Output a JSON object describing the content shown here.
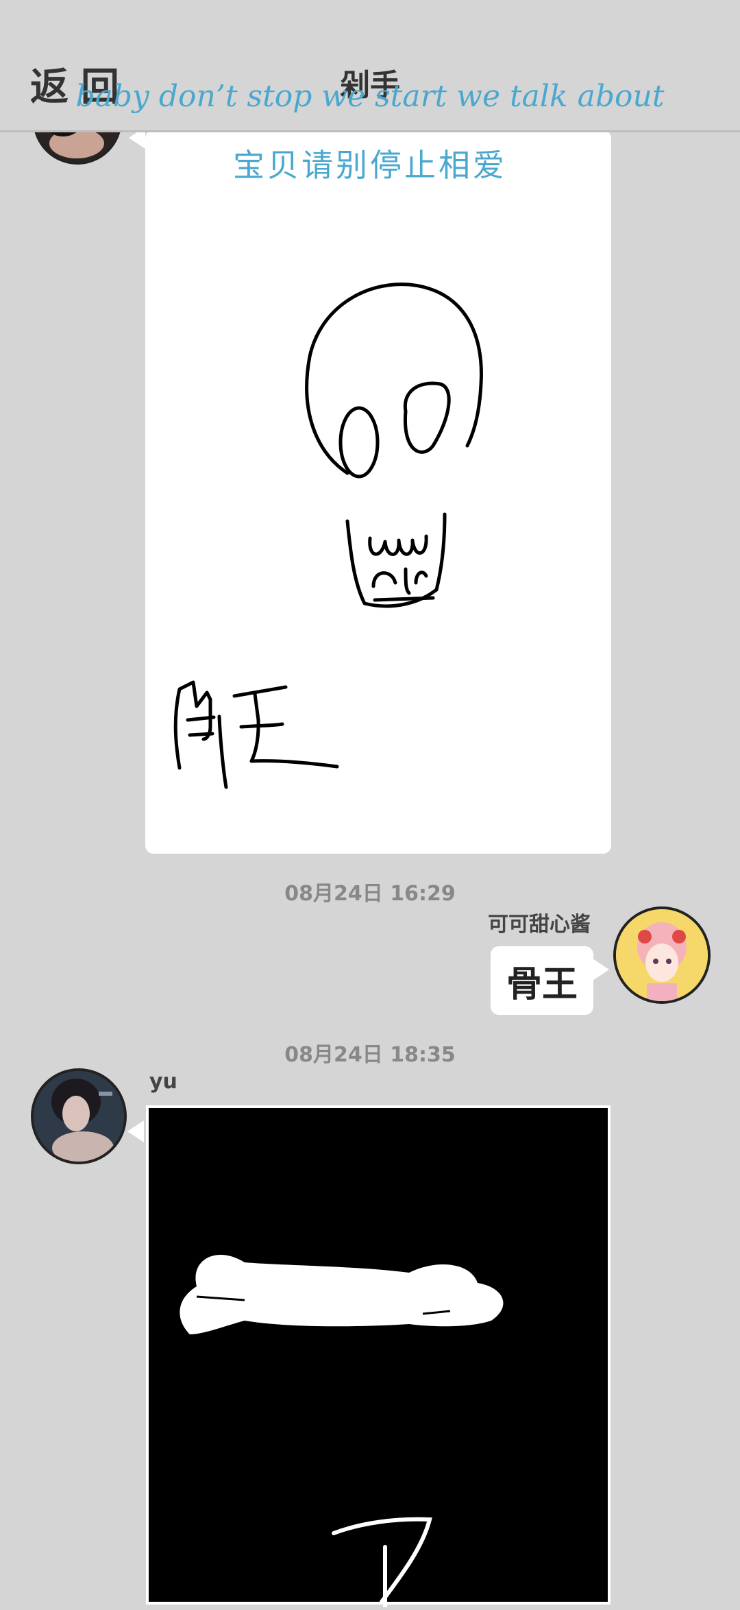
{
  "header": {
    "back_label": "返回",
    "title": "剁手",
    "lyric_line1": "baby don’t stop we start we talk about",
    "lyric_line2": "宝贝请别停止相爱"
  },
  "messages": [
    {
      "sender": "other",
      "type": "drawing",
      "drawing_caption": "骨王"
    },
    {
      "time": "08月24日  16:29",
      "sender": "self",
      "name": "可可甜心酱",
      "type": "text",
      "text": "骨王"
    },
    {
      "time": "08月24日  18:35",
      "sender": "other",
      "name": "yu",
      "type": "drawing",
      "drawing_caption": "骨"
    }
  ],
  "colors": {
    "background": "#d5d5d5",
    "lyric": "#4aa8cf",
    "bubble": "#ffffff"
  }
}
